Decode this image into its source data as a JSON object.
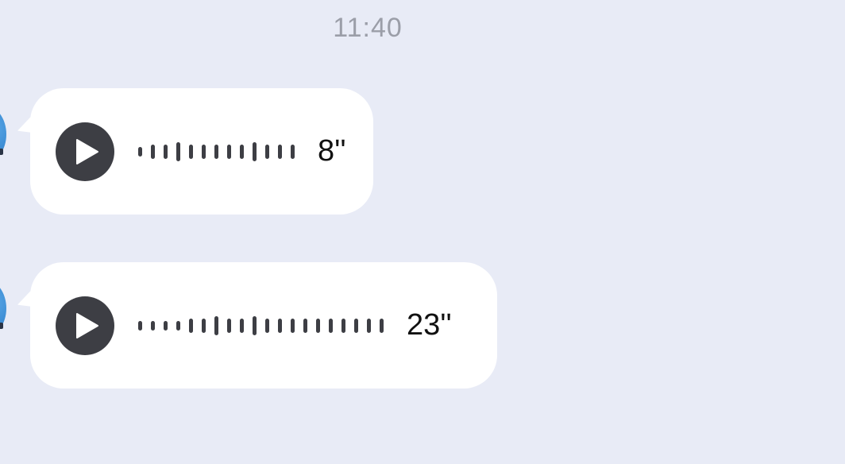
{
  "timestamp": "11:40",
  "colors": {
    "background": "#e8ebf6",
    "bubble": "#ffffff",
    "play_button": "#3d3e44",
    "waveform": "#3d3e44",
    "timestamp_text": "#9b9ea8"
  },
  "messages": [
    {
      "type": "voice",
      "duration": "8''",
      "play_icon": "play-icon",
      "waveform_levels": [
        1,
        2,
        2,
        3,
        2,
        2,
        2,
        2,
        2,
        3,
        2,
        2,
        2
      ]
    },
    {
      "type": "voice",
      "duration": "23''",
      "play_icon": "play-icon",
      "waveform_levels": [
        1,
        1,
        1,
        1,
        2,
        2,
        3,
        2,
        2,
        3,
        2,
        2,
        2,
        2,
        2,
        2,
        2,
        2,
        2,
        2
      ]
    }
  ]
}
